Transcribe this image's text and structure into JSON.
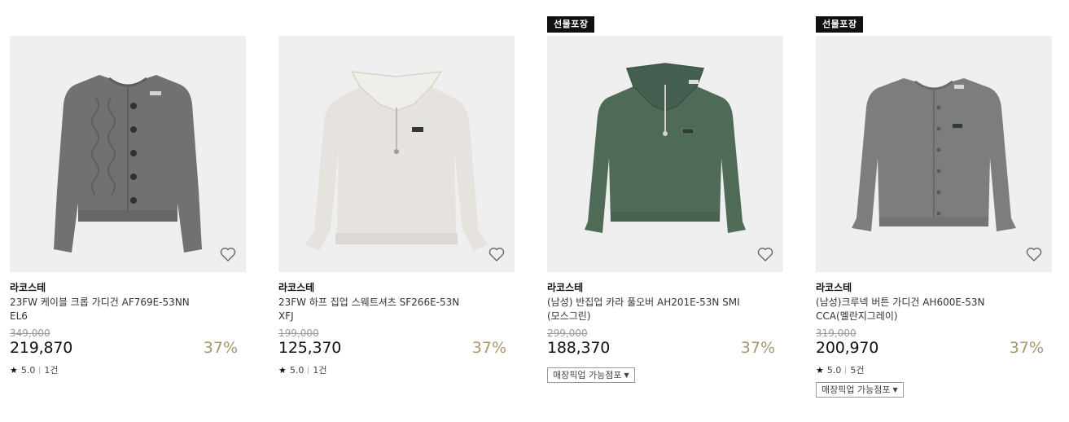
{
  "products": [
    {
      "brand": "라코스테",
      "name": "23FW 케이블 크롭 가디건 AF769E-53NN EL6",
      "original_price": "349,000",
      "price": "219,870",
      "discount": "37%",
      "rating": "5.0",
      "reviews": "1건",
      "sweater_color": "#6f7173"
    },
    {
      "brand": "라코스테",
      "name": "23FW 하프 집업 스웨트셔츠 SF266E-53N XFJ",
      "original_price": "199,000",
      "price": "125,370",
      "discount": "37%",
      "rating": "5.0",
      "reviews": "1건",
      "sweater_color": "#e6e3de"
    },
    {
      "badge": "선물포장",
      "brand": "라코스테",
      "name": "(남성) 반집업 카라 풀오버 AH201E-53N SMI (모스그린)",
      "original_price": "299,000",
      "price": "188,370",
      "discount": "37%",
      "pickup_label": "매장픽업 가능점포",
      "sweater_color": "#4f6b58"
    },
    {
      "badge": "선물포장",
      "brand": "라코스테",
      "name": "(남성)크루넥 버튼 가디건 AH600E-53N CCA(멜란지그레이)",
      "original_price": "319,000",
      "price": "200,970",
      "discount": "37%",
      "rating": "5.0",
      "reviews": "5건",
      "pickup_label": "매장픽업 가능점포",
      "sweater_color": "#7c7d7f"
    }
  ]
}
